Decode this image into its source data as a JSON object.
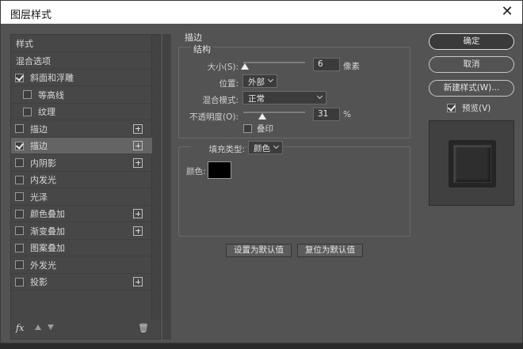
{
  "window": {
    "title": "图层样式",
    "close_glyph": "✕"
  },
  "left_panel": {
    "items": [
      {
        "label": "样式",
        "checkbox": false,
        "checked": false,
        "plus": false,
        "selected": false,
        "indent": 0
      },
      {
        "label": "混合选项",
        "checkbox": false,
        "checked": false,
        "plus": false,
        "selected": false,
        "indent": 0
      },
      {
        "label": "斜面和浮雕",
        "checkbox": true,
        "checked": true,
        "plus": false,
        "selected": false,
        "indent": 0
      },
      {
        "label": "等高线",
        "checkbox": true,
        "checked": false,
        "plus": false,
        "selected": false,
        "indent": 1
      },
      {
        "label": "纹理",
        "checkbox": true,
        "checked": false,
        "plus": false,
        "selected": false,
        "indent": 1
      },
      {
        "label": "描边",
        "checkbox": true,
        "checked": false,
        "plus": true,
        "selected": false,
        "indent": 0
      },
      {
        "label": "描边",
        "checkbox": true,
        "checked": true,
        "plus": true,
        "selected": true,
        "indent": 0
      },
      {
        "label": "内阴影",
        "checkbox": true,
        "checked": false,
        "plus": true,
        "selected": false,
        "indent": 0
      },
      {
        "label": "内发光",
        "checkbox": true,
        "checked": false,
        "plus": false,
        "selected": false,
        "indent": 0
      },
      {
        "label": "光泽",
        "checkbox": true,
        "checked": false,
        "plus": false,
        "selected": false,
        "indent": 0
      },
      {
        "label": "颜色叠加",
        "checkbox": true,
        "checked": false,
        "plus": true,
        "selected": false,
        "indent": 0
      },
      {
        "label": "渐变叠加",
        "checkbox": true,
        "checked": false,
        "plus": true,
        "selected": false,
        "indent": 0
      },
      {
        "label": "图案叠加",
        "checkbox": true,
        "checked": false,
        "plus": false,
        "selected": false,
        "indent": 0
      },
      {
        "label": "外发光",
        "checkbox": true,
        "checked": false,
        "plus": false,
        "selected": false,
        "indent": 0
      },
      {
        "label": "投影",
        "checkbox": true,
        "checked": false,
        "plus": true,
        "selected": false,
        "indent": 0
      }
    ],
    "tools": {
      "fx": "fx",
      "trash": "🗑"
    }
  },
  "stroke": {
    "section_title": "描边",
    "structure_title": "结构",
    "size": {
      "label": "大小(S):",
      "value": "6",
      "unit": "像素",
      "slider_fraction": 0.02
    },
    "position": {
      "label": "位置:",
      "value": "外部"
    },
    "blend_mode": {
      "label": "混合模式:",
      "value": "正常"
    },
    "opacity": {
      "label": "不透明度(O):",
      "value": "31",
      "unit": "%",
      "slider_fraction": 0.31
    },
    "overprint": {
      "label": "叠印",
      "checked": false
    },
    "fill_type": {
      "label": "填充类型:",
      "value": "颜色"
    },
    "color": {
      "label": "颜色:",
      "swatch": "#000000"
    },
    "buttons": {
      "make_default": "设置为默认值",
      "reset_default": "复位为默认值"
    }
  },
  "actions": {
    "ok": "确定",
    "cancel": "取消",
    "new_style": "新建样式(W)...",
    "preview_label": "预览(V)",
    "preview_checked": true
  }
}
